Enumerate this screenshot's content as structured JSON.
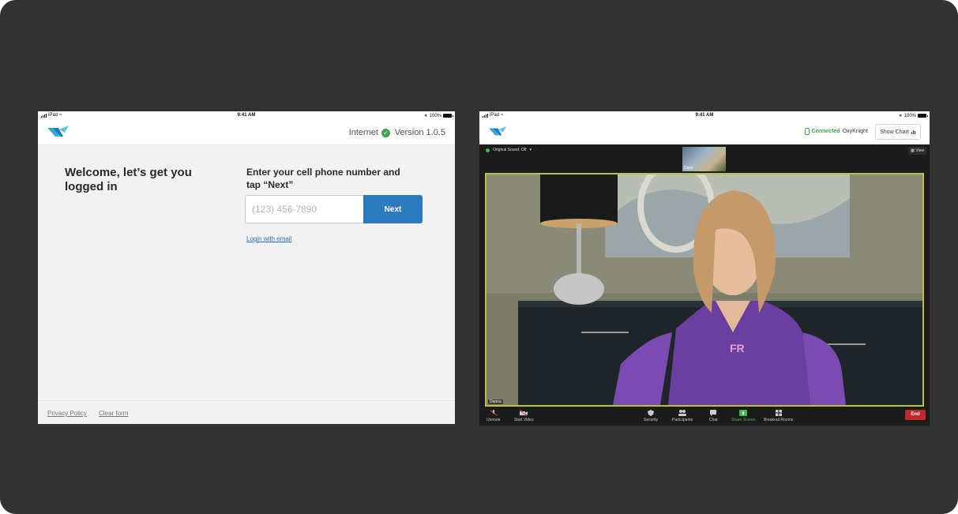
{
  "left": {
    "status": {
      "device": "iPad",
      "time": "9:41 AM",
      "battery": "100%"
    },
    "header": {
      "internet_label": "Internet",
      "version": "Version 1.0.5"
    },
    "welcome": "Welcome, let’s get you logged in",
    "prompt": "Enter your cell phone number and tap “Next”",
    "phone": {
      "placeholder": "(123) 456-7890",
      "value": ""
    },
    "next_label": "Next",
    "email_link": "Login with email",
    "footer": {
      "privacy": "Privacy Policy",
      "clear": "Clear form"
    }
  },
  "right": {
    "status": {
      "device": "iPad",
      "time": "9:41 AM",
      "battery": "100%"
    },
    "header": {
      "connected": "Connected",
      "device_name": "OxyKnight",
      "show_chart": "Show Chart"
    },
    "meeting": {
      "original_sound": "Original Sound: Off",
      "view": "View",
      "thumbnail_name": "Dave",
      "speaker_name": "Donna"
    },
    "toolbar": {
      "unmute": "Unmute",
      "start_video": "Start Video",
      "security": "Security",
      "participants": "Participants",
      "chat": "Chat",
      "share_screen": "Share Screen",
      "breakout_rooms": "Breakout Rooms",
      "end": "End"
    }
  },
  "colors": {
    "primary": "#2d7bbf",
    "success": "#3fa34d",
    "danger": "#c1272d",
    "frame": "#323232",
    "speaker_border": "#b6c53a"
  }
}
